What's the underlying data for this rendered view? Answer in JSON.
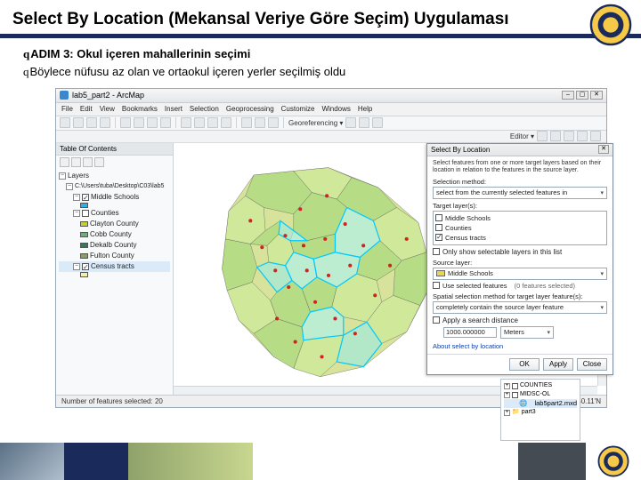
{
  "slide": {
    "title": "Select By Location (Mekansal Veriye Göre Seçim) Uygulaması",
    "bullet1_prefix": "q",
    "bullet1": "ADIM 3: Okul içeren mahallerinin seçimi",
    "bullet2_prefix": "q",
    "bullet2": "Böylece nüfusu az olan ve ortaokul içeren yerler seçilmiş oldu"
  },
  "app": {
    "title": "lab5_part2 - ArcMap",
    "menu": [
      "File",
      "Edit",
      "View",
      "Bookmarks",
      "Insert",
      "Selection",
      "Geoprocessing",
      "Customize",
      "Windows",
      "Help"
    ],
    "georef_label": "Georeferencing ▾",
    "editor_label": "Editor ▾",
    "toc": {
      "header": "Table Of Contents",
      "root": "Layers",
      "dataset_path": "C:\\Users\\tuba\\Desktop\\C03\\lab5",
      "middle_schools": "Middle Schools",
      "counties": "Counties",
      "county_list": [
        "Clayton County",
        "Cobb County",
        "Dekalb County",
        "Fulton County"
      ],
      "census": "Census tracts"
    },
    "status_left": "Number of features selected: 20",
    "status_coord": "85°11.54 33°50.11'N"
  },
  "dialog": {
    "title": "Select By Location",
    "description": "Select features from one or more target layers based on their location in relation to the features in the source layer.",
    "method_label": "Selection method:",
    "method_value": "select from the currently selected features in",
    "target_label": "Target layer(s):",
    "targets": [
      {
        "name": "Middle Schools",
        "checked": false
      },
      {
        "name": "Counties",
        "checked": false
      },
      {
        "name": "Census tracts",
        "checked": true
      }
    ],
    "only_selectable_label": "Only show selectable layers in this list",
    "source_label": "Source layer:",
    "source_value": "Middle Schools",
    "use_selected_label": "Use selected features",
    "use_selected_count": "(0 features selected)",
    "spatial_label": "Spatial selection method for target layer feature(s):",
    "spatial_value": "completely contain the source layer feature",
    "search_dist_label": "Apply a search distance",
    "search_dist_value": "1000.000000",
    "search_dist_unit": "Meters",
    "help_link": "About select by location",
    "buttons": {
      "ok": "OK",
      "apply": "Apply",
      "close": "Close"
    }
  },
  "mini_tree": {
    "items": [
      "COUNTIES",
      "MIDSC-OL",
      "lab5part2.mxd",
      "part3"
    ]
  },
  "swatches": {
    "clayton": "#c5cf2e",
    "cobb": "#6fb07a",
    "dekalb": "#32795f",
    "fulton": "#8c9f63",
    "census": "#f0f0a7",
    "middle": "#2eb0e6"
  }
}
